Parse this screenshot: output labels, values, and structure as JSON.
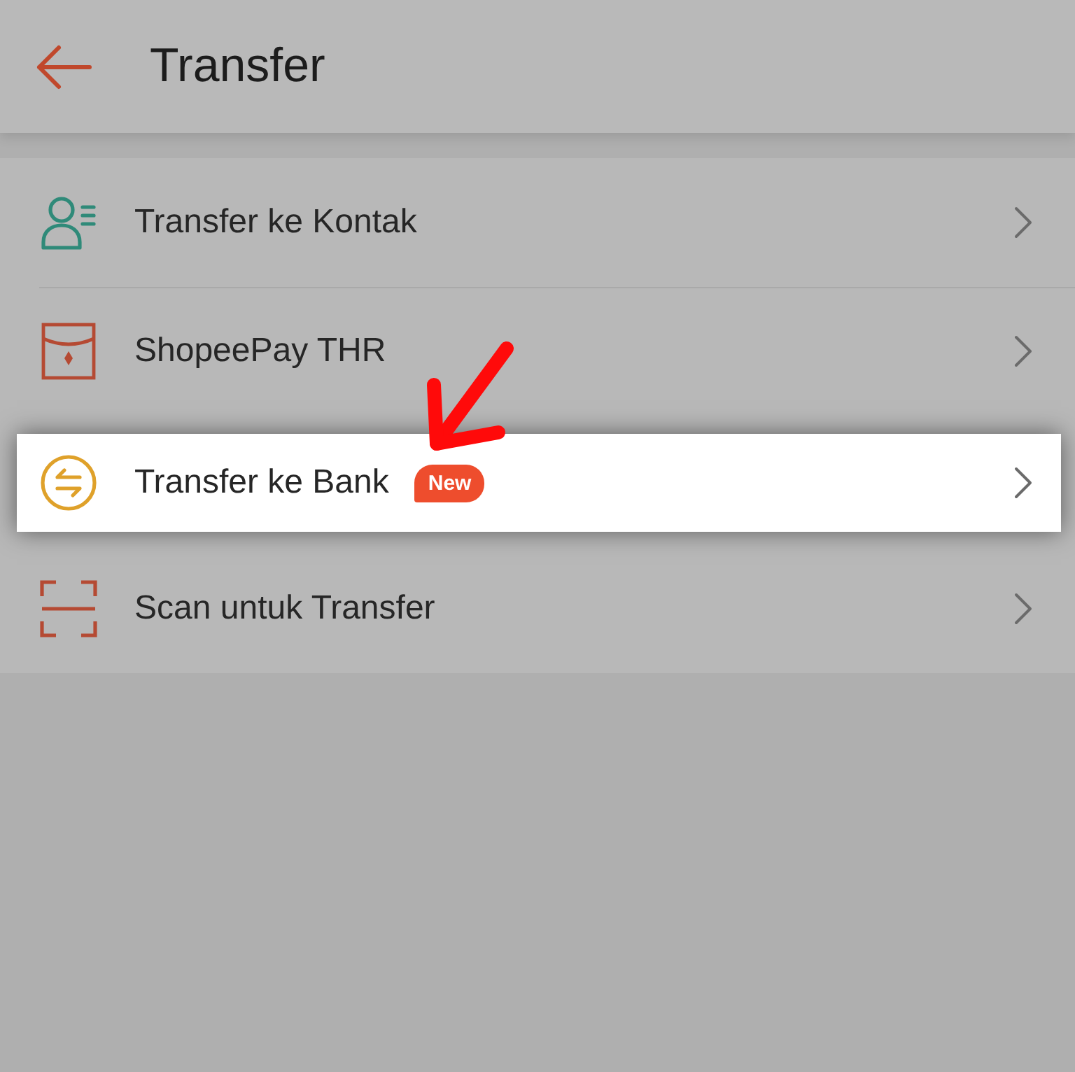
{
  "header": {
    "title": "Transfer"
  },
  "menu_items": [
    {
      "kind": "contact",
      "label": "Transfer ke Kontak",
      "highlighted": false
    },
    {
      "kind": "envelope",
      "label": "ShopeePay THR",
      "highlighted": false
    },
    {
      "kind": "exchange",
      "label": "Transfer ke Bank",
      "badge": "New",
      "highlighted": true
    },
    {
      "kind": "scan",
      "label": "Scan untuk Transfer",
      "highlighted": false
    }
  ]
}
